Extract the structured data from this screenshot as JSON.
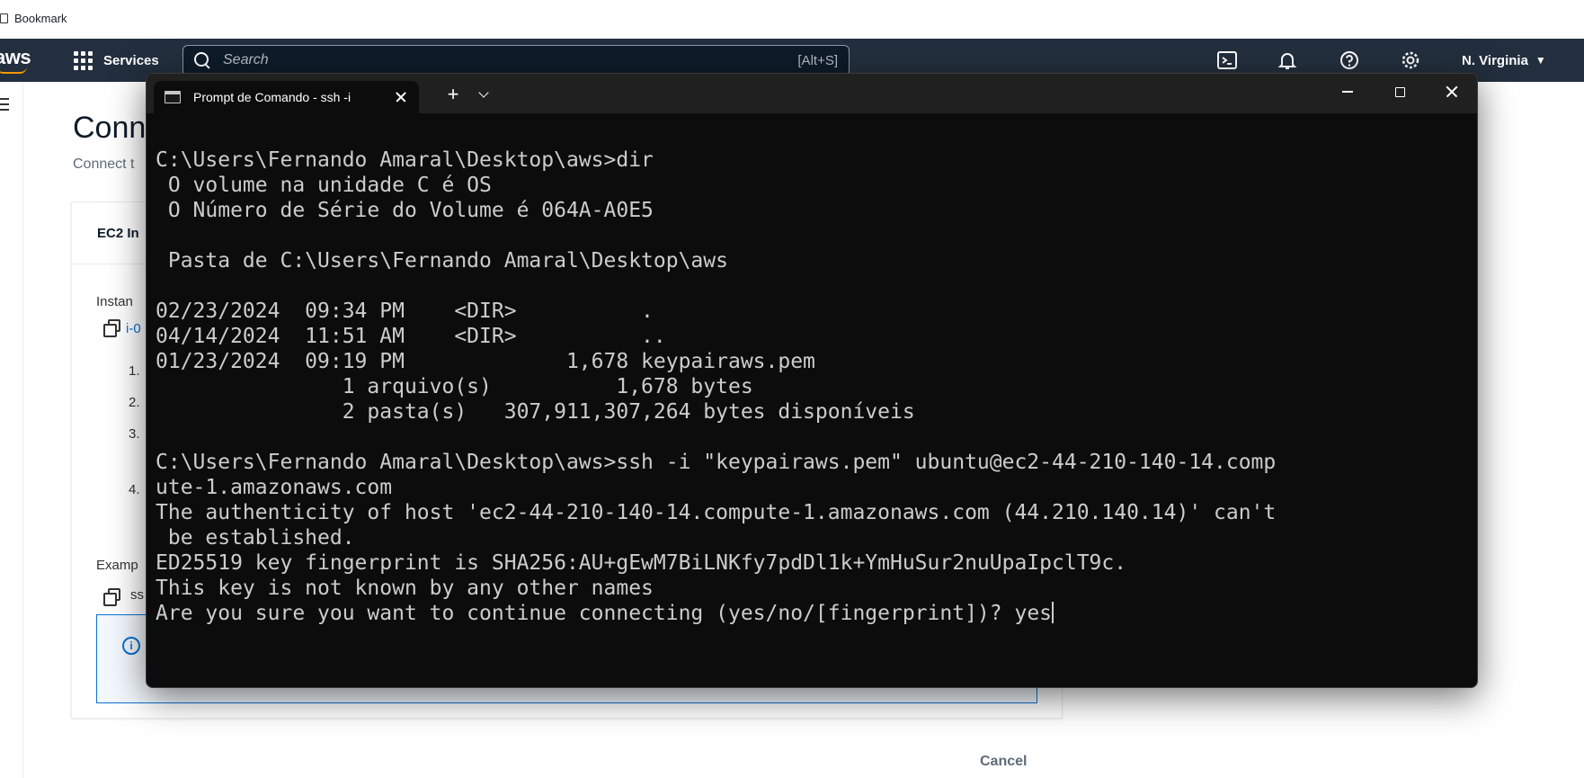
{
  "browser": {
    "bookmark_label": "Bookmark"
  },
  "aws_nav": {
    "logo_text": "aws",
    "services_label": "Services",
    "search_placeholder": "Search",
    "search_shortcut": "[Alt+S]",
    "region_label": "N. Virginia",
    "region_caret": "▼",
    "brand_color": "#232f3e",
    "accent_color": "#ff9900"
  },
  "background_page": {
    "title": "Conn",
    "subtitle": "Connect t",
    "card_tab": "EC2 In",
    "instance_label": "Instan",
    "instance_link": "i-0",
    "steps": [
      "1.",
      "2.",
      "3.",
      "4."
    ],
    "example_label": "Examp",
    "example_command": "ss",
    "info_icon": "i",
    "cancel_label": "Cancel"
  },
  "terminal": {
    "tab_title": "Prompt de Comando - ssh  -i",
    "new_tab_label": "+",
    "lines": [
      "C:\\Users\\Fernando Amaral\\Desktop\\aws>dir",
      " O volume na unidade C é OS",
      " O Número de Série do Volume é 064A-A0E5",
      "",
      " Pasta de C:\\Users\\Fernando Amaral\\Desktop\\aws",
      "",
      "02/23/2024  09:34 PM    <DIR>          .",
      "04/14/2024  11:51 AM    <DIR>          ..",
      "01/23/2024  09:19 PM             1,678 keypairaws.pem",
      "               1 arquivo(s)          1,678 bytes",
      "               2 pasta(s)   307,911,307,264 bytes disponíveis",
      "",
      "C:\\Users\\Fernando Amaral\\Desktop\\aws>ssh -i \"keypairaws.pem\" ubuntu@ec2-44-210-140-14.comp",
      "ute-1.amazonaws.com",
      "The authenticity of host 'ec2-44-210-140-14.compute-1.amazonaws.com (44.210.140.14)' can't",
      " be established.",
      "ED25519 key fingerprint is SHA256:AU+gEwM7BiLNKfy7pdDl1k+YmHuSur2nuUpaIpclT9c.",
      "This key is not known by any other names"
    ],
    "prompt_line": "Are you sure you want to continue connecting (yes/no/[fingerprint])? ",
    "typed_input": "yes"
  }
}
